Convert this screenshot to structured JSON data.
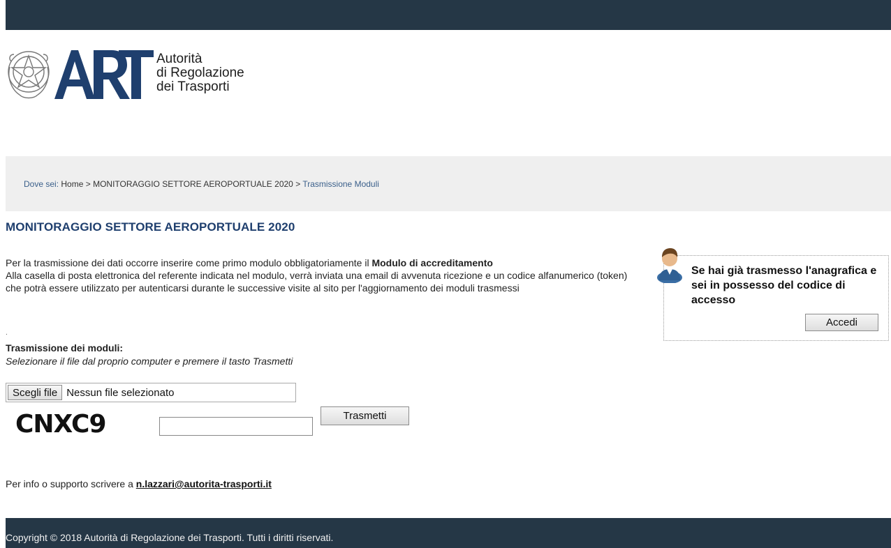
{
  "logo": {
    "line1": "Autorità",
    "line2": "di Regolazione",
    "line3": "dei Trasporti"
  },
  "breadcrumb": {
    "label": "Dove sei:",
    "home": "Home",
    "separator": ">",
    "section": "MONITORAGGIO SETTORE AEROPORTUALE 2020",
    "current": "Trasmissione Moduli"
  },
  "page": {
    "title": "MONITORAGGIO SETTORE AEROPORTUALE 2020"
  },
  "intro": {
    "lead": "Per la trasmissione dei dati occorre inserire come primo modulo obbligatoriamente il ",
    "lead_bold": "Modulo di accreditamento",
    "body": "Alla casella di posta elettronica del referente indicata nel modulo, verrà inviata una email di avvenuta ricezione e un codice alfanumerico (token) che potrà essere utilizzato per autenticarsi durante le successive visite al sito per l'aggiornamento dei moduli trasmessi"
  },
  "dot": ".",
  "upload": {
    "section_title": "Trasmissione dei moduli:",
    "hint": "Selezionare il file dal proprio computer e premere il tasto Trasmetti",
    "choose_label": "Scegli file",
    "no_file": "Nessun file selezionato",
    "captcha_text": "CNXC9",
    "captcha_value": "",
    "submit_label": "Trasmetti"
  },
  "support": {
    "text": "Per info o supporto scrivere a ",
    "email": "n.lazzari@autorita-trasporti.it"
  },
  "login": {
    "message": "Se hai già trasmesso l'anagrafica e sei in possesso del codice di accesso",
    "button_label": "Accedi"
  },
  "footer": {
    "copyright": "Copyright © 2018 Autorità di Regolazione dei Trasporti. Tutti i diritti riservati."
  },
  "colors": {
    "header_bar": "#253746",
    "title_blue": "#1f3f6e",
    "breadcrumb_bg": "#efefef"
  }
}
